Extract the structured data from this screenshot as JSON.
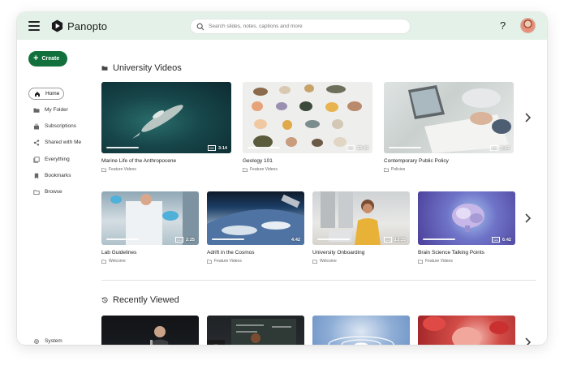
{
  "header": {
    "logo_text": "Panopto",
    "search_placeholder": "Search slides, notes, captions and more",
    "help_label": "?"
  },
  "sidebar": {
    "create_label": "Create",
    "items": [
      {
        "label": "Home",
        "icon": "home-icon"
      },
      {
        "label": "My Folder",
        "icon": "folder-icon"
      },
      {
        "label": "Subscriptions",
        "icon": "subscriptions-icon"
      },
      {
        "label": "Shared with Me",
        "icon": "share-icon"
      },
      {
        "label": "Everything",
        "icon": "library-icon"
      },
      {
        "label": "Bookmarks",
        "icon": "bookmark-icon"
      },
      {
        "label": "Browse",
        "icon": "folder-outline-icon"
      }
    ],
    "system_label": "System"
  },
  "sections": {
    "university_videos": {
      "title": "University Videos",
      "row1": [
        {
          "title": "Marine Life of the Anthropocene",
          "folder": "Feature Videos",
          "duration": "3:14"
        },
        {
          "title": "Geology 101",
          "folder": "Feature Videos",
          "duration": "23:42"
        },
        {
          "title": "Contemporary Public Policy",
          "folder": "Policies",
          "duration": "5:02"
        }
      ],
      "row2": [
        {
          "title": "Lab Guidelines",
          "folder": "Welcome",
          "duration": "2:25"
        },
        {
          "title": "Adrift in the Cosmos",
          "folder": "Feature Videos",
          "duration": "4:42"
        },
        {
          "title": "University Onboarding",
          "folder": "Welcome",
          "duration": "13:25"
        },
        {
          "title": "Brain Science Talking Points",
          "folder": "Feature Videos",
          "duration": "6:42"
        }
      ]
    },
    "recently_viewed": {
      "title": "Recently Viewed"
    }
  },
  "colors": {
    "header_bg": "#e3f1e8",
    "create_button": "#12703d"
  }
}
